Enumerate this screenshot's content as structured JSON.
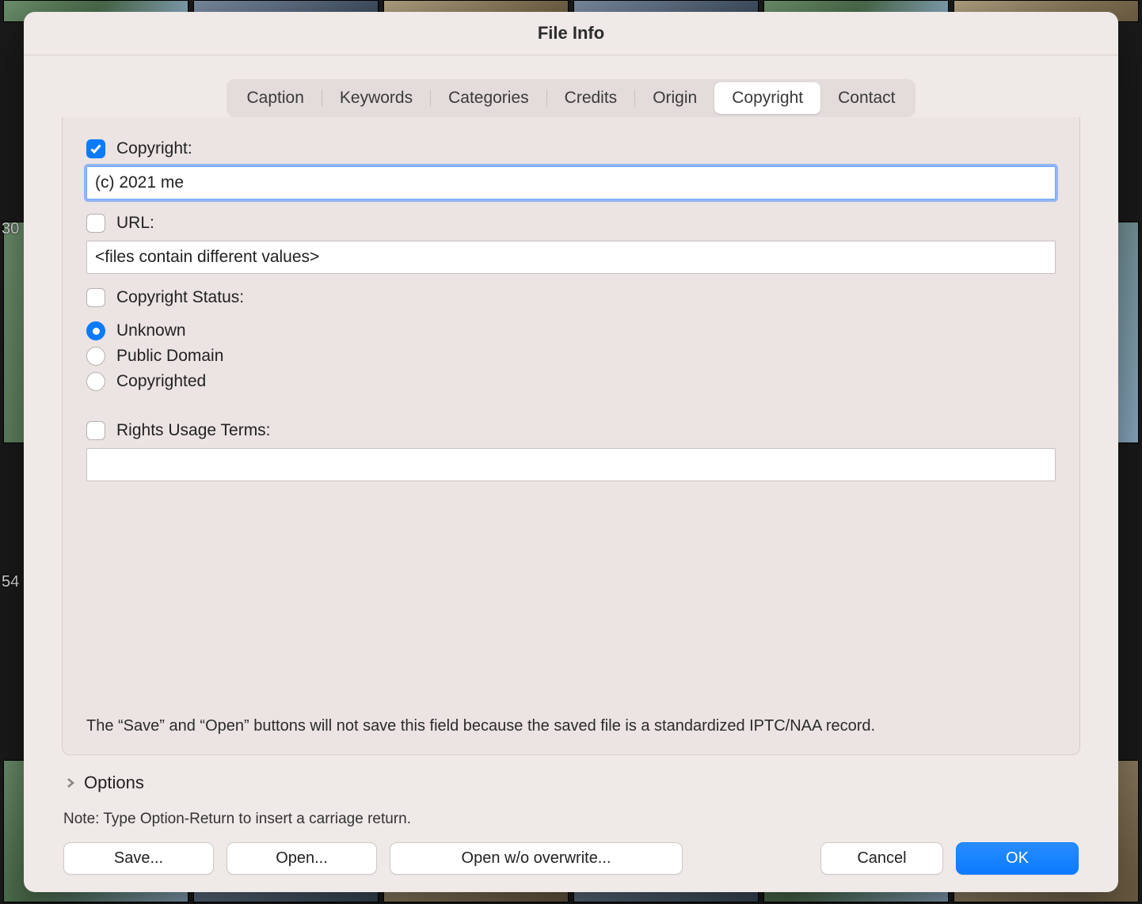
{
  "window": {
    "title": "File Info"
  },
  "tabs": [
    {
      "label": "Caption"
    },
    {
      "label": "Keywords"
    },
    {
      "label": "Categories"
    },
    {
      "label": "Credits"
    },
    {
      "label": "Origin"
    },
    {
      "label": "Copyright",
      "active": true
    },
    {
      "label": "Contact"
    }
  ],
  "copyright": {
    "checkbox_label": "Copyright:",
    "checkbox_checked": true,
    "value": "(c) 2021 me"
  },
  "url": {
    "checkbox_label": "URL:",
    "checkbox_checked": false,
    "value": "<files contain different values>"
  },
  "status": {
    "checkbox_label": "Copyright Status:",
    "checkbox_checked": false,
    "options": [
      {
        "label": "Unknown",
        "selected": true
      },
      {
        "label": "Public Domain",
        "selected": false
      },
      {
        "label": "Copyrighted",
        "selected": false
      }
    ]
  },
  "rights_terms": {
    "checkbox_label": "Rights Usage Terms:",
    "checkbox_checked": false,
    "value": ""
  },
  "save_open_hint": "The “Save” and “Open” buttons will not save this field because the saved file is a standardized IPTC/NAA record.",
  "options_label": "Options",
  "note": "Note: Type Option-Return to insert a carriage return.",
  "buttons": {
    "save": "Save...",
    "open": "Open...",
    "open_wo": "Open w/o overwrite...",
    "cancel": "Cancel",
    "ok": "OK"
  },
  "bg_counts": {
    "a": "30",
    "b": "54"
  }
}
